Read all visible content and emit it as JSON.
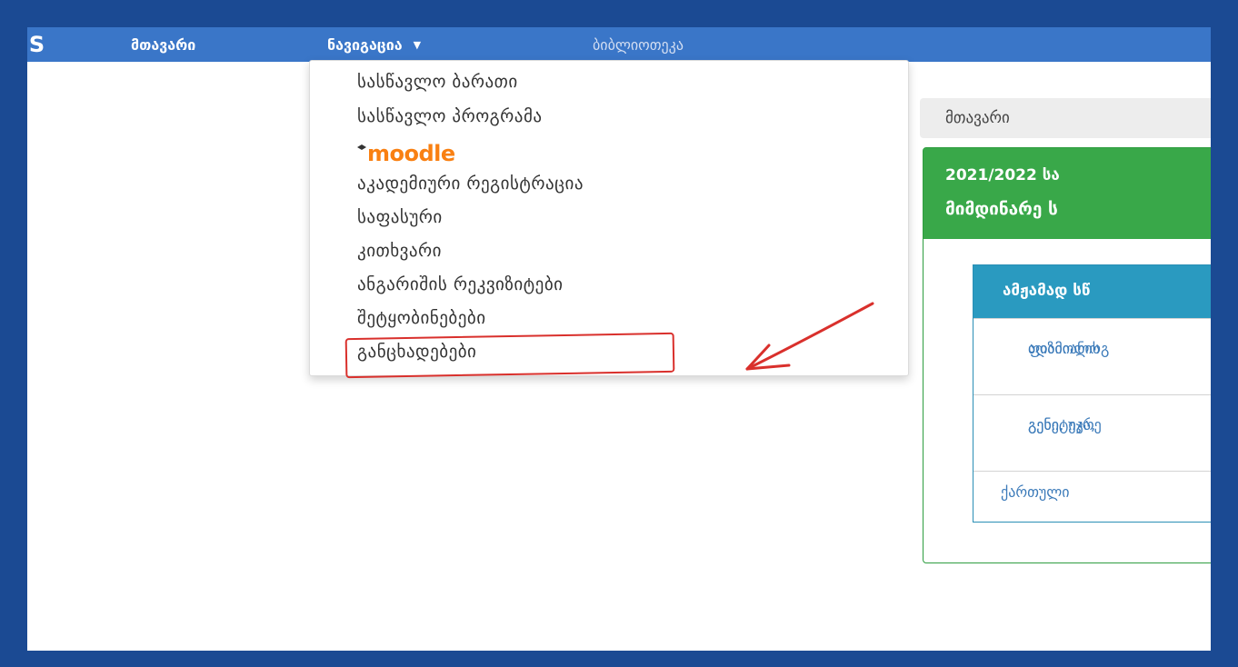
{
  "navbar": {
    "brand": "IS",
    "home": "მთავარი",
    "navigation": "ნავიგაცია",
    "library": "ბიბლიოთეკა",
    "caret_icon": "caret-down-icon"
  },
  "dropdown": {
    "items": [
      "სასწავლო ბარათი",
      "სასწავლო პროგრამა",
      "აკადემიური რეგისტრაცია",
      "საფასური",
      "კითხვარი",
      "ანგარიშის რეკვიზიტები",
      "შეტყობინებები",
      "განცხადებები"
    ],
    "moodle_logo": "moodle",
    "moodle_color": "#f98012"
  },
  "annotation": {
    "color": "#d9302c",
    "highlighted_item": "განცხადებები"
  },
  "breadcrumb": {
    "label": "მთავარი"
  },
  "panel": {
    "heading_line1": "2021/2022 სა",
    "heading_line2": "მიმდინარე ს",
    "heading_color": "#39a849",
    "table_header": "ამჟამად სწ",
    "table_header_color": "#2a9ac0",
    "rows": [
      {
        "line1": "ადამიანის",
        "line2": "ფიზიოლოგ"
      },
      {
        "line1": "გენი, უჯრე",
        "line2": "გენეტიკა, "
      },
      {
        "line1": "ქართული "
      }
    ]
  }
}
